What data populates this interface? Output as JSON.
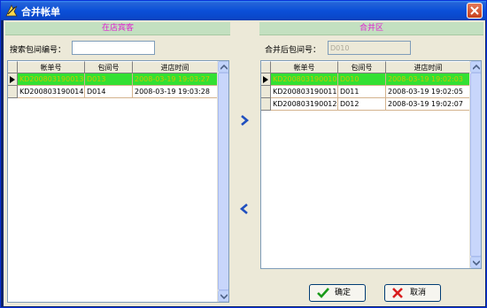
{
  "window": {
    "title": "合并帐单"
  },
  "left_panel": {
    "header": "在店宾客",
    "search_label": "搜索包间编号：",
    "search_value": "",
    "columns": [
      "帐单号",
      "包间号",
      "进店时间"
    ],
    "rows": [
      {
        "bill": "KD200803190013",
        "room": "D013",
        "time": "2008-03-19 19:03:27",
        "selected": true
      },
      {
        "bill": "KD200803190014",
        "room": "D014",
        "time": "2008-03-19 19:03:28",
        "selected": false
      }
    ]
  },
  "right_panel": {
    "header": "合并区",
    "merged_label": "合并后包间号：",
    "merged_value": "D010",
    "columns": [
      "帐单号",
      "包间号",
      "进店时间"
    ],
    "rows": [
      {
        "bill": "KD200803190010",
        "room": "D010",
        "time": "2008-03-19 19:02:03",
        "selected": true
      },
      {
        "bill": "KD200803190011",
        "room": "D011",
        "time": "2008-03-19 19:02:05",
        "selected": false
      },
      {
        "bill": "KD200803190012",
        "room": "D012",
        "time": "2008-03-19 19:02:07",
        "selected": false
      }
    ]
  },
  "buttons": {
    "confirm": "确定",
    "cancel": "取消"
  },
  "colors": {
    "selected_row": "#33e033",
    "panel_header": "#c3e0c0",
    "header_text": "#e020d0"
  }
}
